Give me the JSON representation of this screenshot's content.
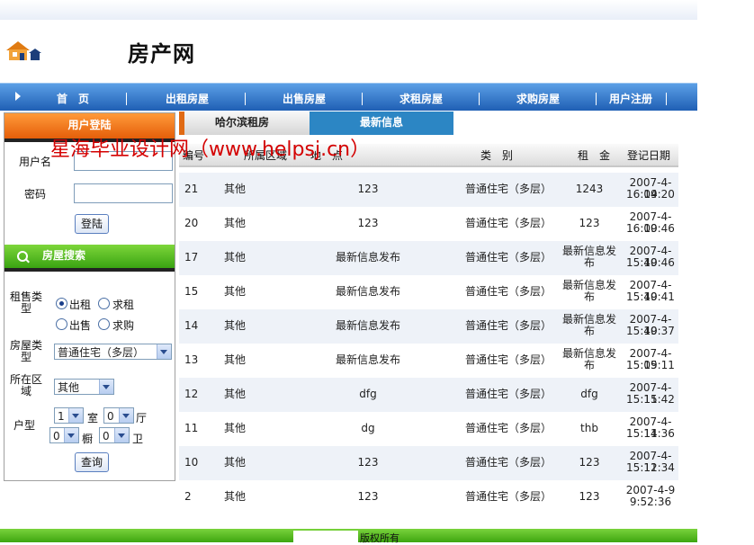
{
  "header": {
    "site_title": "房产网"
  },
  "nav": {
    "items": [
      "首　页",
      "出租房屋",
      "出售房屋",
      "求租房屋",
      "求购房屋",
      "用户注册"
    ]
  },
  "login": {
    "title": "用户登陆",
    "username_label": "用户名",
    "password_label": "密码",
    "username_value": "",
    "password_value": "",
    "submit_label": "登陆"
  },
  "search": {
    "title": "房屋搜索",
    "type_label": "租售类型",
    "type_options": [
      "出租",
      "求租",
      "出售",
      "求购"
    ],
    "type_selected": "出租",
    "house_type_label": "房屋类型",
    "house_type_value": "普通住宅（多层）",
    "area_label": "所在区域",
    "area_value": "其他",
    "layout_label": "户型",
    "rooms_value": "1",
    "rooms_unit": "室",
    "halls_value": "0",
    "halls_unit": "厅",
    "kitchens_value": "0",
    "kitchens_unit": "橱",
    "baths_value": "0",
    "baths_unit": "卫",
    "submit_label": "查询"
  },
  "tabs": {
    "tab1": "哈尔滨租房",
    "tab2": "最新信息"
  },
  "watermark": "星海毕业设计网（www.helpsj.cn）",
  "table": {
    "headers": [
      "编号",
      "所属区域",
      "地　点",
      "类　别",
      "租　金",
      "登记日期"
    ],
    "rows": [
      {
        "id": "21",
        "area": "其他",
        "place": "123",
        "type": "普通住宅（多层）",
        "rent": "1243",
        "date": "2007-4-19",
        "time": "16:04:20"
      },
      {
        "id": "20",
        "area": "其他",
        "place": "123",
        "type": "普通住宅（多层）",
        "rent": "123",
        "date": "2007-4-19",
        "time": "16:00:46"
      },
      {
        "id": "17",
        "area": "其他",
        "place": "最新信息发布",
        "type": "普通住宅（多层）",
        "rent": "最新信息发布",
        "date": "2007-4-19",
        "time": "15:40:46"
      },
      {
        "id": "15",
        "area": "其他",
        "place": "最新信息发布",
        "type": "普通住宅（多层）",
        "rent": "最新信息发布",
        "date": "2007-4-19",
        "time": "15:40:41"
      },
      {
        "id": "14",
        "area": "其他",
        "place": "最新信息发布",
        "type": "普通住宅（多层）",
        "rent": "最新信息发布",
        "date": "2007-4-19",
        "time": "15:40:37"
      },
      {
        "id": "13",
        "area": "其他",
        "place": "最新信息发布",
        "type": "普通住宅（多层）",
        "rent": "最新信息发布",
        "date": "2007-4-19",
        "time": "15:05:11"
      },
      {
        "id": "12",
        "area": "其他",
        "place": "dfg",
        "type": "普通住宅（多层）",
        "rent": "dfg",
        "date": "2007-4-11",
        "time": "15:15:42"
      },
      {
        "id": "11",
        "area": "其他",
        "place": "dg",
        "type": "普通住宅（多层）",
        "rent": "thb",
        "date": "2007-4-11",
        "time": "15:14:36"
      },
      {
        "id": "10",
        "area": "其他",
        "place": "123",
        "type": "普通住宅（多层）",
        "rent": "123",
        "date": "2007-4-11",
        "time": "15:12:34"
      },
      {
        "id": "2",
        "area": "其他",
        "place": "123",
        "type": "普通住宅（多层）",
        "rent": "123",
        "date": "2007-4-9",
        "time": "9:52:36"
      }
    ]
  },
  "footer": {
    "text": "版权所有"
  },
  "colors": {
    "nav": "#1f5fb4",
    "login_header": "#e35a06",
    "search_header": "#2f9b0c",
    "tab_active": "#2c86c4",
    "watermark": "#d40000"
  }
}
